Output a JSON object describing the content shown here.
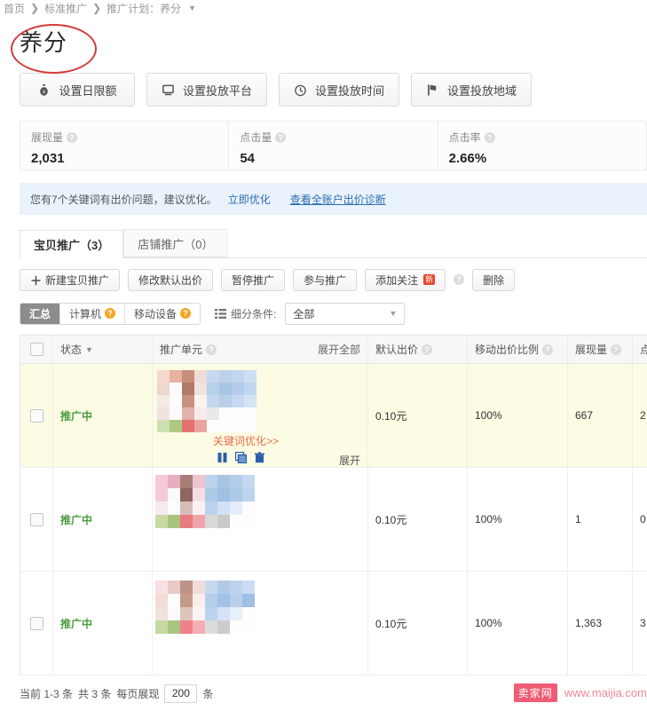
{
  "breadcrumb": {
    "items": [
      "首页",
      "标准推广",
      "推广计划：养分"
    ],
    "separator": "❯",
    "caret": "▼"
  },
  "page_title": "养分",
  "annotation": {
    "shape": "ellipse",
    "color": "#d33b3b"
  },
  "action_buttons": [
    {
      "label": "设置日限额",
      "icon": "money-bag-icon"
    },
    {
      "label": "设置投放平台",
      "icon": "monitor-icon"
    },
    {
      "label": "设置投放时间",
      "icon": "clock-icon"
    },
    {
      "label": "设置投放地域",
      "icon": "map-pin-icon"
    }
  ],
  "stats": [
    {
      "label": "展现量",
      "value": "2,031"
    },
    {
      "label": "点击量",
      "value": "54"
    },
    {
      "label": "点击率",
      "value": "2.66%"
    }
  ],
  "notice": {
    "text": "您有7个关键词有出价问题，建议优化。",
    "link1": "立即优化",
    "link2": "查看全账户出价诊断"
  },
  "tabs": [
    {
      "label": "宝贝推广（3）",
      "active": true
    },
    {
      "label": "店铺推广（0）",
      "active": false
    }
  ],
  "toolbar": [
    {
      "label": "新建宝贝推广",
      "plus": "＋"
    },
    {
      "label": "修改默认出价"
    },
    {
      "label": "暂停推广"
    },
    {
      "label": "参与推广"
    },
    {
      "label": "添加关注",
      "badge": "新"
    },
    {
      "label": "删除"
    }
  ],
  "toolbar_help": "?",
  "subfilter": {
    "segments": [
      {
        "label": "汇总",
        "active": true
      },
      {
        "label": "计算机",
        "active": false,
        "badge": "?"
      },
      {
        "label": "移动设备",
        "active": false,
        "badge": "?"
      }
    ],
    "filter_label": "细分条件:",
    "filter_icon": "list-icon",
    "select_value": "全部",
    "select_caret": "▼"
  },
  "table": {
    "headers": [
      {
        "key": "checkbox",
        "label": ""
      },
      {
        "key": "state",
        "label": "状态",
        "sort": "▼"
      },
      {
        "key": "unit",
        "label": "推广单元",
        "help": "?",
        "extra": "展开全部"
      },
      {
        "key": "bid",
        "label": "默认出价",
        "help": "?"
      },
      {
        "key": "ratio",
        "label": "移动出价比例",
        "help": "?"
      },
      {
        "key": "impression",
        "label": "展现量",
        "help": "?"
      },
      {
        "key": "clicks",
        "label": "点"
      }
    ],
    "rows": [
      {
        "state": "推广中",
        "bid": "0.10元",
        "ratio": "100%",
        "impression": "667",
        "clicks": "2",
        "highlighted": true,
        "keyword_link": "关键词优化>>",
        "expand_label": "展开",
        "icons": [
          "pause-icon",
          "copy-icon",
          "trash-icon"
        ]
      },
      {
        "state": "推广中",
        "bid": "0.10元",
        "ratio": "100%",
        "impression": "1",
        "clicks": "0",
        "highlighted": false
      },
      {
        "state": "推广中",
        "bid": "0.10元",
        "ratio": "100%",
        "impression": "1,363",
        "clicks": "3",
        "highlighted": false
      }
    ]
  },
  "footer": {
    "current": "当前 1-3 条",
    "total": "共 3 条",
    "per_page_label": "每页展现",
    "per_page_value": "200",
    "unit": "条"
  },
  "watermark": {
    "badge": "卖家网",
    "url": "www.maijia.com"
  }
}
